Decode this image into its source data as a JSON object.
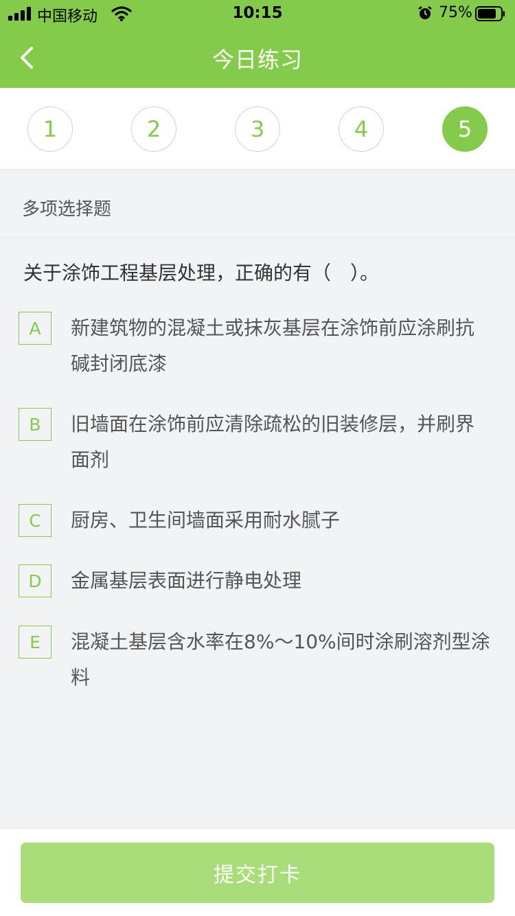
{
  "status_bar": {
    "carrier": "中国移动",
    "time": "10:15",
    "battery": "75%"
  },
  "header": {
    "title": "今日练习",
    "back_icon": "chevron-left-icon"
  },
  "steps": [
    "1",
    "2",
    "3",
    "4",
    "5"
  ],
  "active_step": 5,
  "question_type": "多项选择题",
  "question": "关于涂饰工程基层处理，正确的有（　）。",
  "options": [
    {
      "letter": "A",
      "text": "新建筑物的混凝土或抹灰基层在涂饰前应涂刷抗碱封闭底漆"
    },
    {
      "letter": "B",
      "text": "旧墙面在涂饰前应清除疏松的旧装修层，并刷界面剂"
    },
    {
      "letter": "C",
      "text": "厨房、卫生间墙面采用耐水腻子"
    },
    {
      "letter": "D",
      "text": "金属基层表面进行静电处理"
    },
    {
      "letter": "E",
      "text": "混凝土基层含水率在8%～10%间时涂刷溶剂型涂料"
    }
  ],
  "submit_label": "提交打卡",
  "colors": {
    "accent": "#85cb4b",
    "submit_bg": "#a8dd7a",
    "background": "#f2f3f5"
  }
}
